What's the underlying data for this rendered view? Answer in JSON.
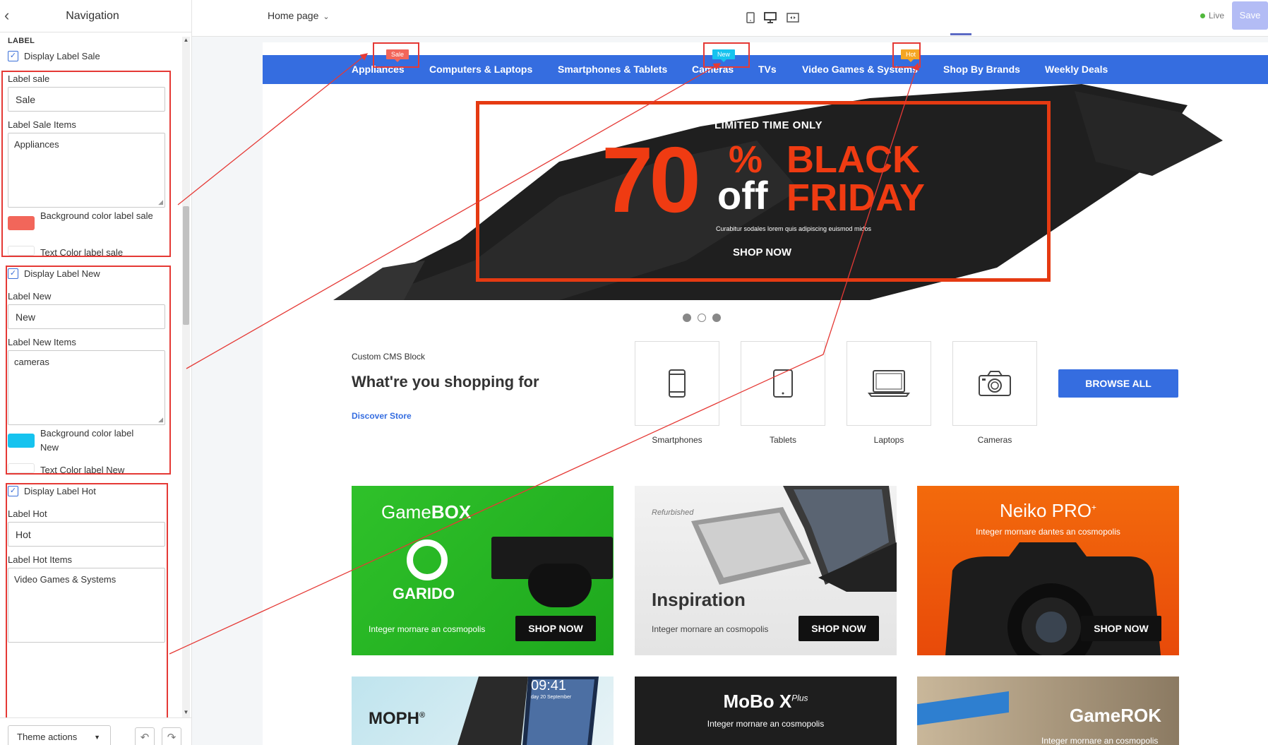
{
  "sidebar": {
    "title": "Navigation",
    "section_label": "LABEL",
    "sale": {
      "display_label": "Display Label Sale",
      "label_field": "Label sale",
      "label_value": "Sale",
      "items_field": "Label Sale Items",
      "items_value": "Appliances",
      "bg_label": "Background color label sale",
      "bg_color": "#f2665a",
      "text_label": "Text Color label sale"
    },
    "new": {
      "display_label": "Display Label New",
      "label_field": "Label New",
      "label_value": "New",
      "items_field": "Label New Items",
      "items_value": "cameras",
      "bg_label": "Background color label New",
      "bg_color": "#16c3ef",
      "text_label": "Text Color label New"
    },
    "hot": {
      "display_label": "Display Label Hot",
      "label_field": "Label Hot",
      "label_value": "Hot",
      "items_field": "Label Hot Items",
      "items_value": "Video Games & Systems"
    },
    "footer": {
      "theme_actions": "Theme actions"
    }
  },
  "topbar": {
    "page_select": "Home page",
    "live": "Live",
    "save": "Save"
  },
  "store": {
    "nav": [
      "Appliances",
      "Computers & Laptops",
      "Smartphones & Tablets",
      "Cameras",
      "TVs",
      "Video Games & Systems",
      "Shop By Brands",
      "Weekly Deals"
    ],
    "badges": {
      "sale": "Sale",
      "new": "New",
      "hot": "Hot"
    },
    "badge_colors": {
      "sale": "#f2665a",
      "new": "#16c3ef",
      "hot": "#f5a623"
    },
    "banner": {
      "limited": "LIMITED TIME ONLY",
      "big": "70",
      "pct": "%",
      "off": "off",
      "black": "BLACK",
      "friday": "FRIDAY",
      "sub": "Curabitur sodales lorem quis adipiscing euismod midos",
      "cta": "SHOP NOW",
      "slide_count": 3,
      "active_slide": 1
    },
    "cms": {
      "small": "Custom CMS Block",
      "title": "What're you shopping for",
      "link": "Discover Store",
      "categories": [
        "Smartphones",
        "Tablets",
        "Laptops",
        "Cameras"
      ],
      "browse": "BROWSE ALL"
    },
    "cards": [
      {
        "brand1": "Game",
        "brand2": "BOX",
        "sub": "GARIDO",
        "desc": "Integer mornare an cosmopolis",
        "cta": "SHOP NOW"
      },
      {
        "tag": "Refurbished",
        "title": "Inspiration",
        "desc": "Integer mornare an cosmopolis",
        "cta": "SHOP NOW"
      },
      {
        "title": "Neiko PRO",
        "sup": "+",
        "desc": "Integer mornare dantes an cosmopolis",
        "cta": "SHOP NOW"
      },
      {
        "title": "MOPH",
        "sup": "®",
        "time": "09:41",
        "date": "day 20 September"
      },
      {
        "title": "MoBo X",
        "sup": "Plus",
        "desc": "Integer mornare an cosmopolis"
      },
      {
        "title": "GameROK",
        "desc": "Integer mornare an cosmopolis"
      }
    ]
  },
  "accent": "#356de0"
}
